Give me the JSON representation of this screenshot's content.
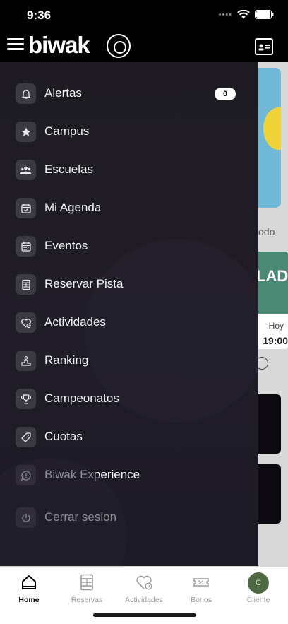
{
  "statusbar": {
    "time": "9:36"
  },
  "header": {
    "brand": "biwak"
  },
  "menu": {
    "items": [
      {
        "label": "Alertas",
        "icon": "bell-icon",
        "badge": "0"
      },
      {
        "label": "Campus",
        "icon": "star-icon"
      },
      {
        "label": "Escuelas",
        "icon": "group-icon"
      },
      {
        "label": "Mi Agenda",
        "icon": "calendar-check-icon"
      },
      {
        "label": "Eventos",
        "icon": "calendar-grid-icon"
      },
      {
        "label": "Reservar Pista",
        "icon": "court-icon"
      },
      {
        "label": "Actividades",
        "icon": "heart-check-icon"
      },
      {
        "label": "Ranking",
        "icon": "podium-icon"
      },
      {
        "label": "Campeonatos",
        "icon": "trophy-icon"
      },
      {
        "label": "Cuotas",
        "icon": "tag-icon"
      },
      {
        "label": "Biwak Experience",
        "icon": "chat-bubble-icon"
      },
      {
        "label": "Cerrar sesion",
        "icon": "power-icon"
      }
    ]
  },
  "background": {
    "todo_fragment": "odo",
    "event_title_fragment": "LADA",
    "event_day": "Hoy",
    "event_time": "19:00"
  },
  "tabbar": {
    "tabs": [
      {
        "label": "Home",
        "icon": "home-icon",
        "active": true
      },
      {
        "label": "Reservas",
        "icon": "court-icon"
      },
      {
        "label": "Actividades",
        "icon": "heart-check-icon"
      },
      {
        "label": "Bonos",
        "icon": "ticket-percent-icon"
      },
      {
        "label": "Cliente",
        "icon": "avatar",
        "avatar_letter": "C"
      }
    ]
  },
  "colors": {
    "drawer_bg": "#1e1b22",
    "icon_tile": "#3b3942",
    "avatar_bg": "#4f6a42"
  }
}
